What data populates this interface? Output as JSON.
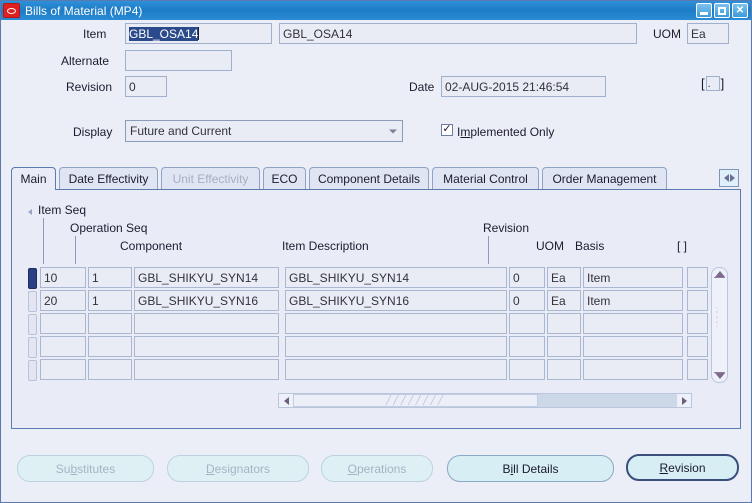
{
  "window": {
    "title": "Bills of Material (MP4)",
    "logo_icon": "oracle-logo-icon",
    "minimize_label": "Minimize",
    "maximize_label": "Maximize",
    "close_label": "Close",
    "close_glyph": "✕"
  },
  "header": {
    "item_label": "Item",
    "item_value": "GBL_OSA14",
    "item_description_value": "GBL_OSA14",
    "uom_label": "UOM",
    "uom_value": "Ea",
    "alternate_label": "Alternate",
    "alternate_value": "",
    "revision_label": "Revision",
    "revision_value": "0",
    "date_label": "Date",
    "date_value": "02-AUG-2015 21:46:54",
    "dff_open": "[",
    "dff_value": ".",
    "dff_close": "]",
    "display_label": "Display",
    "display_value": "Future and Current",
    "display_arrow_icon": "chevron-down-icon",
    "implemented_only_label_pre": "I",
    "implemented_only_mnemonic": "m",
    "implemented_only_label_post": "plemented Only",
    "implemented_only_checked": true,
    "check_glyph": "✓"
  },
  "tabs": [
    {
      "label": "Main",
      "active": true,
      "disabled": false
    },
    {
      "label": "Date Effectivity",
      "active": false,
      "disabled": false
    },
    {
      "label": "Unit Effectivity",
      "active": false,
      "disabled": true
    },
    {
      "label": "ECO",
      "active": false,
      "disabled": false
    },
    {
      "label": "Component Details",
      "active": false,
      "disabled": false
    },
    {
      "label": "Material Control",
      "active": false,
      "disabled": false
    },
    {
      "label": "Order Management",
      "active": false,
      "disabled": false
    }
  ],
  "tab_scroll_icon": "tab-scroll-left-right-icon",
  "grid": {
    "headers": {
      "item_seq": "Item Seq",
      "operation_seq": "Operation Seq",
      "component": "Component",
      "item_description": "Item Description",
      "revision": "Revision",
      "uom": "UOM",
      "basis": "Basis",
      "dff": "[ ]"
    },
    "rows": [
      {
        "current": true,
        "item_seq": "10",
        "operation_seq": "1",
        "component": "GBL_SHIKYU_SYN14",
        "item_description": "GBL_SHIKYU_SYN14",
        "revision": "0",
        "uom": "Ea",
        "basis": "Item",
        "dff": ""
      },
      {
        "current": false,
        "item_seq": "20",
        "operation_seq": "1",
        "component": "GBL_SHIKYU_SYN16",
        "item_description": "GBL_SHIKYU_SYN16",
        "revision": "0",
        "uom": "Ea",
        "basis": "Item",
        "dff": ""
      },
      {
        "current": false,
        "item_seq": "",
        "operation_seq": "",
        "component": "",
        "item_description": "",
        "revision": "",
        "uom": "",
        "basis": "",
        "dff": ""
      },
      {
        "current": false,
        "item_seq": "",
        "operation_seq": "",
        "component": "",
        "item_description": "",
        "revision": "",
        "uom": "",
        "basis": "",
        "dff": ""
      },
      {
        "current": false,
        "item_seq": "",
        "operation_seq": "",
        "component": "",
        "item_description": "",
        "revision": "",
        "uom": "",
        "basis": "",
        "dff": ""
      }
    ],
    "vscroll_up_icon": "scroll-up-arrow-icon",
    "vscroll_down_icon": "scroll-down-arrow-icon",
    "hscroll_left_icon": "scroll-left-arrow-icon",
    "hscroll_right_icon": "scroll-right-arrow-icon",
    "grip_glyph": "╱╱╱╱╱╱╱╱"
  },
  "buttons": [
    {
      "pre": "Su",
      "mn": "b",
      "post": "stitutes",
      "disabled": true,
      "focus": false
    },
    {
      "pre": "",
      "mn": "D",
      "post": "esignators",
      "disabled": true,
      "focus": false
    },
    {
      "pre": "",
      "mn": "O",
      "post": "perations",
      "disabled": true,
      "focus": false
    },
    {
      "pre": "B",
      "mn": "i",
      "post": "ll Details",
      "disabled": false,
      "focus": false
    },
    {
      "pre": "",
      "mn": "R",
      "post": "evision",
      "disabled": false,
      "focus": true
    }
  ],
  "colors": {
    "titlebar": "#1d7cc6",
    "canvas": "#eceef7",
    "field": "#e9ebf5",
    "selection": "#2b4a8b",
    "button": "#d6eef4",
    "border": "#5a7ab0"
  }
}
